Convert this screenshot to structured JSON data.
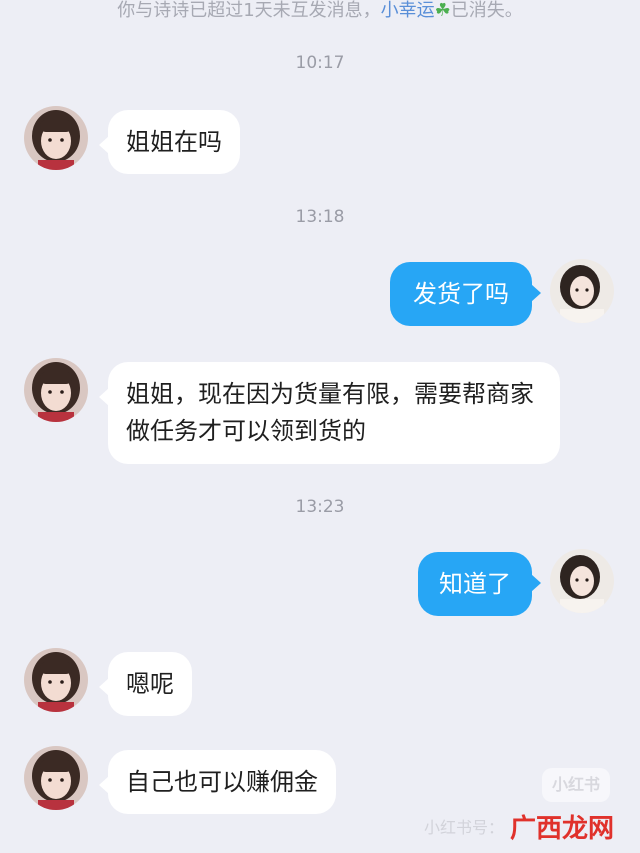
{
  "notice": {
    "prefix": "你与诗诗已超过1天未互发消息，",
    "link": "小幸运",
    "suffix": "已消失。"
  },
  "messages": [
    {
      "time": "10:17"
    },
    {
      "side": "in",
      "text": "姐姐在吗"
    },
    {
      "time": "13:18"
    },
    {
      "side": "out",
      "text": "发货了吗"
    },
    {
      "side": "in",
      "text": "姐姐，现在因为货量有限，需要帮商家做任务才可以领到货的"
    },
    {
      "time": "13:23"
    },
    {
      "side": "out",
      "text": "知道了"
    },
    {
      "side": "in",
      "text": "嗯呢"
    },
    {
      "side": "in",
      "text": "自己也可以赚佣金"
    }
  ],
  "watermark": {
    "logo": "小红书",
    "id": "小红书号：",
    "site": "广西龙网"
  },
  "colors": {
    "background": "#edeef5",
    "outgoing_bubble": "#27a6f5",
    "incoming_bubble": "#ffffff",
    "timestamp": "#9a9ca6"
  }
}
